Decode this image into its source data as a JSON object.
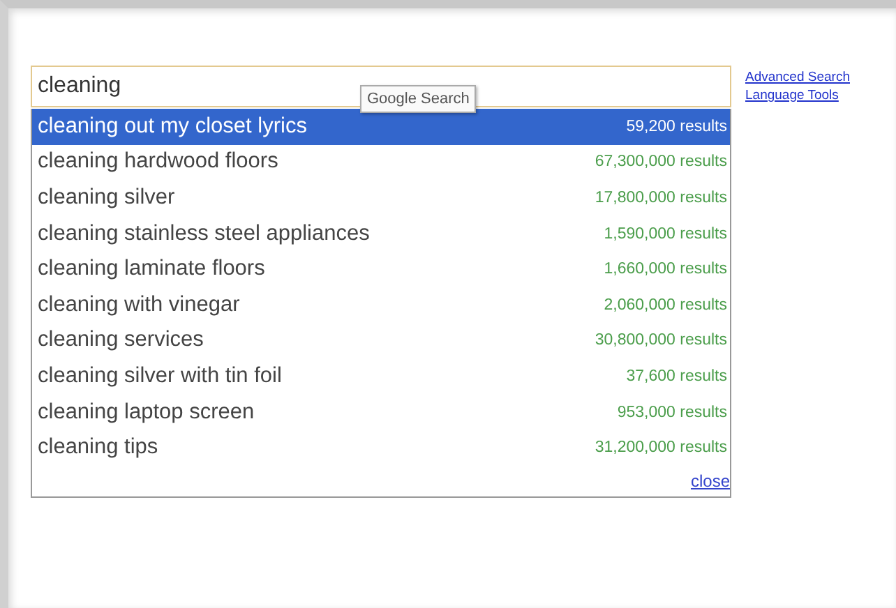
{
  "search": {
    "value": "cleaning"
  },
  "tooltip": "Google Search",
  "suggestions": [
    {
      "query": "cleaning out my closet lyrics",
      "results": "59,200 results",
      "selected": true
    },
    {
      "query": "cleaning hardwood floors",
      "results": "67,300,000 results",
      "selected": false
    },
    {
      "query": "cleaning silver",
      "results": "17,800,000 results",
      "selected": false
    },
    {
      "query": "cleaning stainless steel appliances",
      "results": "1,590,000 results",
      "selected": false
    },
    {
      "query": "cleaning laminate floors",
      "results": "1,660,000 results",
      "selected": false
    },
    {
      "query": "cleaning with vinegar",
      "results": "2,060,000 results",
      "selected": false
    },
    {
      "query": "cleaning services",
      "results": "30,800,000 results",
      "selected": false
    },
    {
      "query": "cleaning silver with tin foil",
      "results": "37,600 results",
      "selected": false
    },
    {
      "query": "cleaning laptop screen",
      "results": "953,000 results",
      "selected": false
    },
    {
      "query": "cleaning tips",
      "results": "31,200,000 results",
      "selected": false
    }
  ],
  "close_link": "close",
  "side_links": [
    "Advanced Search",
    "Language Tools"
  ]
}
